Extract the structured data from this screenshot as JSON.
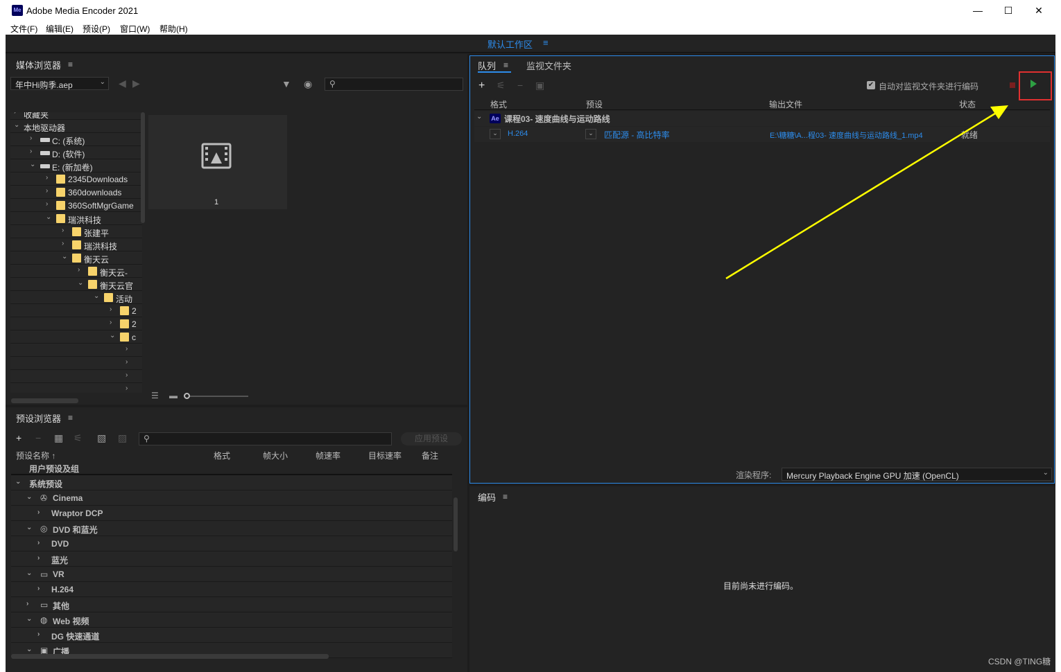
{
  "window": {
    "title": "Adobe Media Encoder 2021",
    "logo_text": "Me",
    "minimize": "—",
    "maximize": "☐",
    "close": "✕"
  },
  "menu": [
    "文件(F)",
    "编辑(E)",
    "预设(P)",
    "窗口(W)",
    "帮助(H)"
  ],
  "workspace": {
    "label": "默认工作区",
    "menu_icon": "≡"
  },
  "media_browser": {
    "title": "媒体浏览器",
    "menu_icon": "≡",
    "path_value": "年中Hi购季.aep",
    "tree": [
      {
        "label": "收藏夹",
        "level": 0,
        "arrow": "›",
        "type": "none"
      },
      {
        "label": "本地驱动器",
        "level": 0,
        "arrow": "⌄",
        "type": "none"
      },
      {
        "label": "C: (系统)",
        "level": 1,
        "arrow": "›",
        "type": "drive"
      },
      {
        "label": "D: (软件)",
        "level": 1,
        "arrow": "›",
        "type": "drive"
      },
      {
        "label": "E: (新加卷)",
        "level": 1,
        "arrow": "⌄",
        "type": "drive"
      },
      {
        "label": "2345Downloads",
        "level": 2,
        "arrow": "›",
        "type": "folder"
      },
      {
        "label": "360downloads",
        "level": 2,
        "arrow": "›",
        "type": "folder"
      },
      {
        "label": "360SoftMgrGame",
        "level": 2,
        "arrow": "›",
        "type": "folder"
      },
      {
        "label": "瑞洪科技",
        "level": 2,
        "arrow": "⌄",
        "type": "folder"
      },
      {
        "label": "张建平",
        "level": 3,
        "arrow": "›",
        "type": "folder"
      },
      {
        "label": "瑞洪科技",
        "level": 3,
        "arrow": "›",
        "type": "folder"
      },
      {
        "label": "衡天云",
        "level": 3,
        "arrow": "⌄",
        "type": "folder"
      },
      {
        "label": "衡天云-",
        "level": 4,
        "arrow": "›",
        "type": "folder"
      },
      {
        "label": "衡天云官",
        "level": 4,
        "arrow": "⌄",
        "type": "folder"
      },
      {
        "label": "活动",
        "level": 5,
        "arrow": "⌄",
        "type": "folder"
      },
      {
        "label": "2",
        "level": 6,
        "arrow": "›",
        "type": "folder"
      },
      {
        "label": "2",
        "level": 6,
        "arrow": "›",
        "type": "folder"
      },
      {
        "label": "c",
        "level": 6,
        "arrow": "⌄",
        "type": "folder"
      },
      {
        "label": "",
        "level": 7,
        "arrow": "›",
        "type": "none"
      },
      {
        "label": "",
        "level": 7,
        "arrow": "›",
        "type": "none"
      },
      {
        "label": "",
        "level": 7,
        "arrow": "›",
        "type": "none"
      },
      {
        "label": "",
        "level": 7,
        "arrow": "›",
        "type": "none"
      }
    ],
    "thumbnail_label": "1"
  },
  "queue": {
    "tab_queue": "队列",
    "tab_watch": "监视文件夹",
    "menu_icon": "≡",
    "auto_encode_label": "自动对监视文件夹进行编码",
    "columns": [
      "格式",
      "预设",
      "输出文件",
      "状态"
    ],
    "group_badge": "Ae",
    "group_name": "课程03- 速度曲线与运动路线",
    "item": {
      "format": "H.264",
      "preset": "匹配源 - 高比特率",
      "output": "E:\\糖糖\\A...程03- 速度曲线与运动路线_1.mp4",
      "status": "就绪"
    },
    "renderer_label": "渲染程序:",
    "renderer_value": "Mercury Playback Engine GPU 加速 (OpenCL)"
  },
  "encoding": {
    "title": "编码",
    "menu_icon": "≡",
    "empty_message": "目前尚未进行编码。"
  },
  "preset_browser": {
    "title": "预设浏览器",
    "menu_icon": "≡",
    "apply_button": "应用预设",
    "columns": [
      "预设名称 ↑",
      "格式",
      "帧大小",
      "帧速率",
      "目标速率",
      "备注"
    ],
    "rows": [
      {
        "label": "用户预设及组",
        "level": 0,
        "arrow": "",
        "icon": ""
      },
      {
        "label": "系统预设",
        "level": 0,
        "arrow": "⌄",
        "icon": ""
      },
      {
        "label": "Cinema",
        "level": 1,
        "arrow": "⌄",
        "icon": "film-reel-icon"
      },
      {
        "label": "Wraptor DCP",
        "level": 2,
        "arrow": "›",
        "icon": ""
      },
      {
        "label": "DVD 和蓝光",
        "level": 1,
        "arrow": "⌄",
        "icon": "disc-icon"
      },
      {
        "label": "DVD",
        "level": 2,
        "arrow": "›",
        "icon": ""
      },
      {
        "label": "蓝光",
        "level": 2,
        "arrow": "›",
        "icon": ""
      },
      {
        "label": "VR",
        "level": 1,
        "arrow": "⌄",
        "icon": "vr-headset-icon"
      },
      {
        "label": "H.264",
        "level": 2,
        "arrow": "›",
        "icon": ""
      },
      {
        "label": "其他",
        "level": 1,
        "arrow": "›",
        "icon": "monitor-icon"
      },
      {
        "label": "Web 视频",
        "level": 1,
        "arrow": "⌄",
        "icon": "globe-icon"
      },
      {
        "label": "DG 快速通道",
        "level": 2,
        "arrow": "›",
        "icon": ""
      },
      {
        "label": "广播",
        "level": 1,
        "arrow": "⌄",
        "icon": "tv-icon"
      }
    ]
  },
  "watermark": "CSDN @TING糖",
  "colors": {
    "accent": "#2d8ceb",
    "panel": "#232323",
    "annotation_arrow": "#ffff00",
    "highlight_box": "#e03030",
    "play": "#2ea043"
  }
}
